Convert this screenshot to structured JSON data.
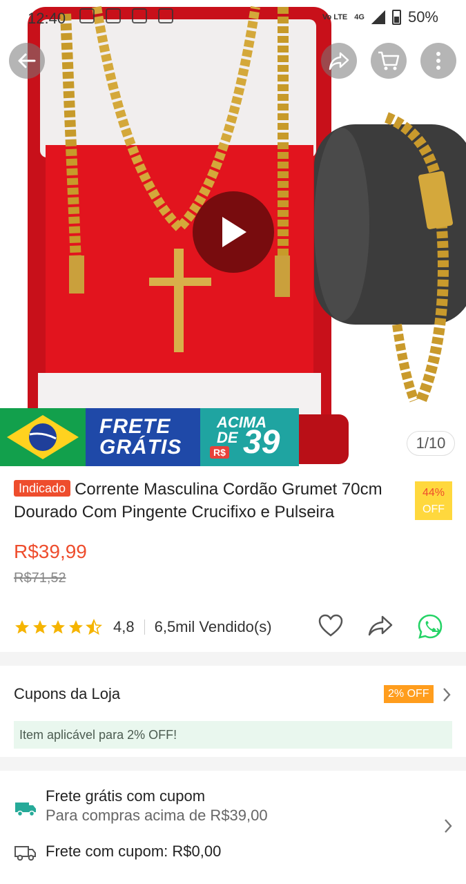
{
  "status_bar": {
    "time": "12:40",
    "network": "4G",
    "volte": "Vo LTE",
    "battery": "50%"
  },
  "hero": {
    "page_indicator": "1/10",
    "promo": {
      "line1": "FRETE",
      "line2": "GRÁTIS",
      "acima": "ACIMA",
      "de": "DE",
      "currency": "R$",
      "amount": "39"
    }
  },
  "product": {
    "badge": "Indicado",
    "title": "Corrente Masculina Cordão Grumet 70cm Dourado Com Pingente Crucifixo e Pulseira",
    "discount_pct": "44%",
    "discount_off": "OFF",
    "price": "R$39,99",
    "old_price": "R$71,52",
    "rating": "4,8",
    "sold": "6,5mil Vendido(s)"
  },
  "coupons": {
    "title": "Cupons da Loja",
    "tag": "2% OFF",
    "note": "Item aplicável para 2% OFF!"
  },
  "shipping": {
    "line1": "Frete grátis com cupom",
    "line2": "Para compras acima de R$39,00",
    "line3": "Frete com cupom: R$0,00"
  },
  "colors": {
    "accent": "#ee4d2d",
    "discount_bg": "#ffd83d",
    "coupon_tag": "#ff9d1d",
    "whatsapp": "#25d366"
  }
}
